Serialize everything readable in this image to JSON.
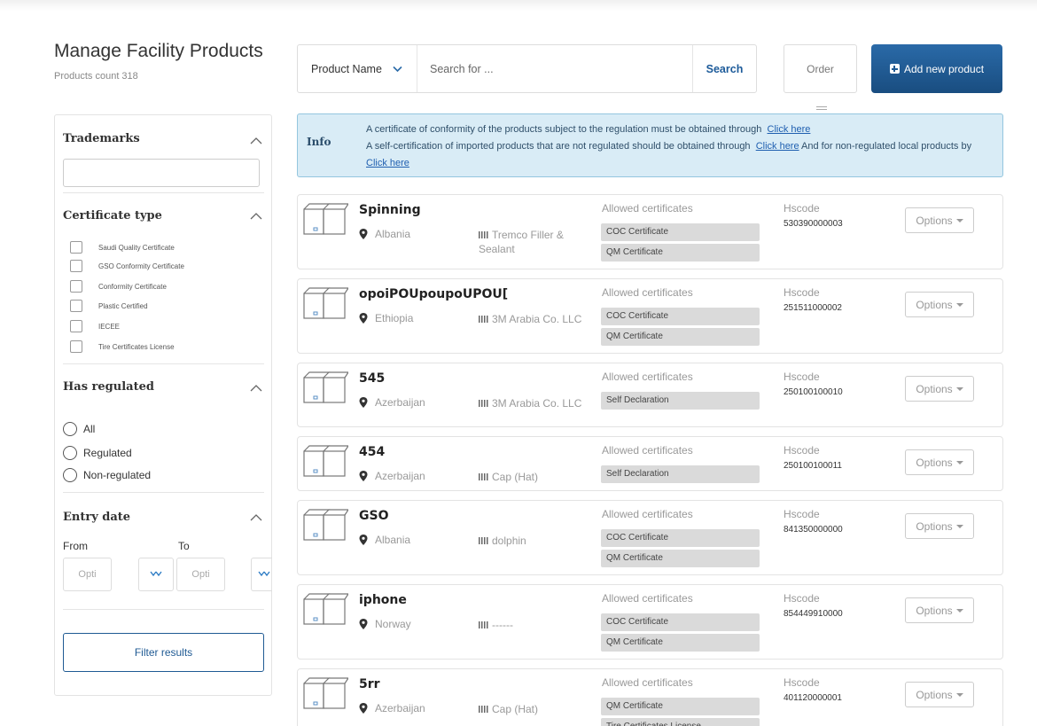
{
  "header": {
    "title": "Manage Facility Products",
    "count": "Products count 318"
  },
  "search": {
    "field_select": "Product Name",
    "placeholder": "Search for ...",
    "button": "Search"
  },
  "order_label": "Order",
  "add_button": "Add new product",
  "sidebar": {
    "trademarks": {
      "title": "Trademarks"
    },
    "certificate_type": {
      "title": "Certificate type",
      "options": [
        "Saudi Quality Certificate",
        "GSO Conformity Certificate",
        "Conformity Certificate",
        "Plastic Certified",
        "IECEE",
        "Tire Certificates License"
      ]
    },
    "has_regulated": {
      "title": "Has regulated",
      "options": [
        "All",
        "Regulated",
        "Non-regulated"
      ]
    },
    "entry_date": {
      "title": "Entry date",
      "from_label": "From",
      "to_label": "To",
      "from_placeholder": "Opti",
      "to_placeholder": "Opti"
    },
    "filter_button": "Filter results"
  },
  "info": {
    "label": "Info",
    "line1": "A certificate of conformity of the products subject to the regulation must be obtained through",
    "link": "Click here",
    "line2": "A self-certification of imported products that are not regulated should be obtained through",
    "line2_tail": "And for non-regulated",
    "line3": "local products by"
  },
  "labels": {
    "allowed": "Allowed certificates",
    "hscode": "Hscode",
    "options": "Options"
  },
  "products": [
    {
      "name": "Spinning",
      "country": "Albania",
      "brand": "Tremco Filler & Sealant",
      "certs": [
        "COC Certificate",
        "QM Certificate"
      ],
      "hscode": "530390000003"
    },
    {
      "name": "opoiPOUpoupoUPOU[",
      "country": "Ethiopia",
      "brand": "3M Arabia Co. LLC",
      "certs": [
        "COC Certificate",
        "QM Certificate"
      ],
      "hscode": "251511000002"
    },
    {
      "name": "545",
      "country": "Azerbaijan",
      "brand": "3M Arabia Co. LLC",
      "certs": [
        "Self Declaration"
      ],
      "hscode": "250100100010"
    },
    {
      "name": "454",
      "country": "Azerbaijan",
      "brand": "Cap (Hat)",
      "certs": [
        "Self Declaration"
      ],
      "hscode": "250100100011"
    },
    {
      "name": "GSO",
      "country": "Albania",
      "brand": "dolphin",
      "certs": [
        "COC Certificate",
        "QM Certificate"
      ],
      "hscode": "841350000000"
    },
    {
      "name": "iphone",
      "country": "Norway",
      "brand": "------",
      "certs": [
        "COC Certificate",
        "QM Certificate"
      ],
      "hscode": "854449910000"
    },
    {
      "name": "5rr",
      "country": "Azerbaijan",
      "brand": "Cap (Hat)",
      "certs": [
        "QM Certificate",
        "Tire Certificates License"
      ],
      "hscode": "401120000001"
    }
  ]
}
